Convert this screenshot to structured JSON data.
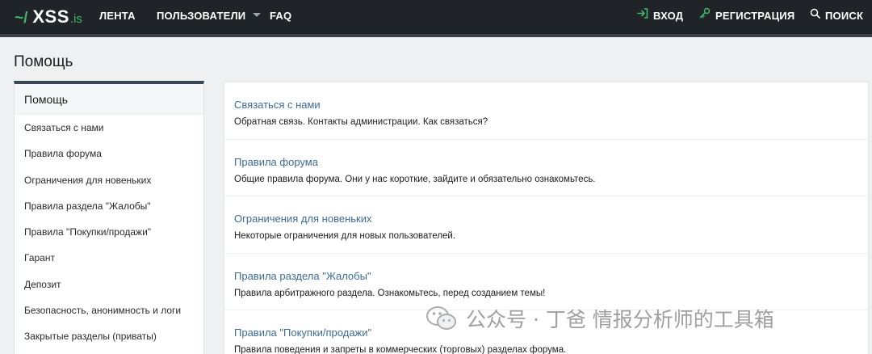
{
  "header": {
    "logo_tilde": "~/",
    "logo_name": "XSS",
    "logo_tld": ".is",
    "nav": [
      {
        "label": "ЛЕНТА"
      },
      {
        "label": "ПОЛЬЗОВАТЕЛИ"
      },
      {
        "label": "FAQ"
      }
    ],
    "login": "ВХОД",
    "register": "РЕГИСТРАЦИЯ",
    "search": "ПОИСК",
    "accent": "#3fb867"
  },
  "page": {
    "title": "Помощь"
  },
  "sidebar": {
    "heading": "Помощь",
    "items": [
      "Связаться с нами",
      "Правила форума",
      "Ограничения для новеньких",
      "Правила раздела \"Жалобы\"",
      "Правила \"Покупки/продажи\"",
      "Гарант",
      "Депозит",
      "Безопасность, анонимность и логи",
      "Закрытые разделы (приваты)"
    ]
  },
  "entries": [
    {
      "title": "Связаться с нами",
      "desc": "Обратная связь. Контакты администрации. Как связаться?"
    },
    {
      "title": "Правила форума",
      "desc": "Общие правила форума. Они у нас короткие, зайдите и обязательно ознакомьтесь."
    },
    {
      "title": "Ограничения для новеньких",
      "desc": "Некоторые ограничения для новых пользователей."
    },
    {
      "title": "Правила раздела \"Жалобы\"",
      "desc": "Правила арбитражного раздела. Ознакомьтесь, перед созданием темы!"
    },
    {
      "title": "Правила \"Покупки/продажи\"",
      "desc": "Правила поведения и запреты в коммерческих (торговых) разделах форума."
    }
  ],
  "watermark": {
    "text": "公众号 · 丁爸 情报分析师的工具箱"
  }
}
